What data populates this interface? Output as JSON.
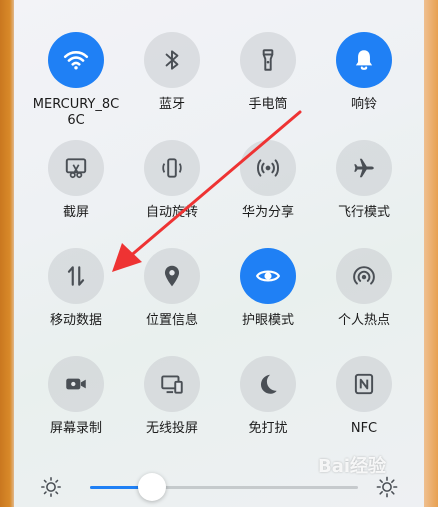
{
  "tiles": [
    {
      "label": "MERCURY_8C6C",
      "icon": "wifi-icon",
      "active": true
    },
    {
      "label": "蓝牙",
      "icon": "bluetooth-icon",
      "active": false
    },
    {
      "label": "手电筒",
      "icon": "flashlight-icon",
      "active": false
    },
    {
      "label": "响铃",
      "icon": "bell-icon",
      "active": true
    },
    {
      "label": "截屏",
      "icon": "screenshot-icon",
      "active": false
    },
    {
      "label": "自动旋转",
      "icon": "rotate-icon",
      "active": false
    },
    {
      "label": "华为分享",
      "icon": "share-icon",
      "active": false
    },
    {
      "label": "飞行模式",
      "icon": "airplane-icon",
      "active": false
    },
    {
      "label": "移动数据",
      "icon": "mobile-data-icon",
      "active": false
    },
    {
      "label": "位置信息",
      "icon": "location-icon",
      "active": false
    },
    {
      "label": "护眼模式",
      "icon": "eye-icon",
      "active": true
    },
    {
      "label": "个人热点",
      "icon": "hotspot-icon",
      "active": false
    },
    {
      "label": "屏幕录制",
      "icon": "screen-record-icon",
      "active": false
    },
    {
      "label": "无线投屏",
      "icon": "cast-icon",
      "active": false
    },
    {
      "label": "免打扰",
      "icon": "moon-icon",
      "active": false
    },
    {
      "label": "NFC",
      "icon": "nfc-icon",
      "active": false
    }
  ],
  "brightness": {
    "level": 0.23
  },
  "watermark": "Bai经验",
  "colors": {
    "active": "#1f80f5",
    "icon": "#4a4f55",
    "arrow": "#ee3333"
  }
}
